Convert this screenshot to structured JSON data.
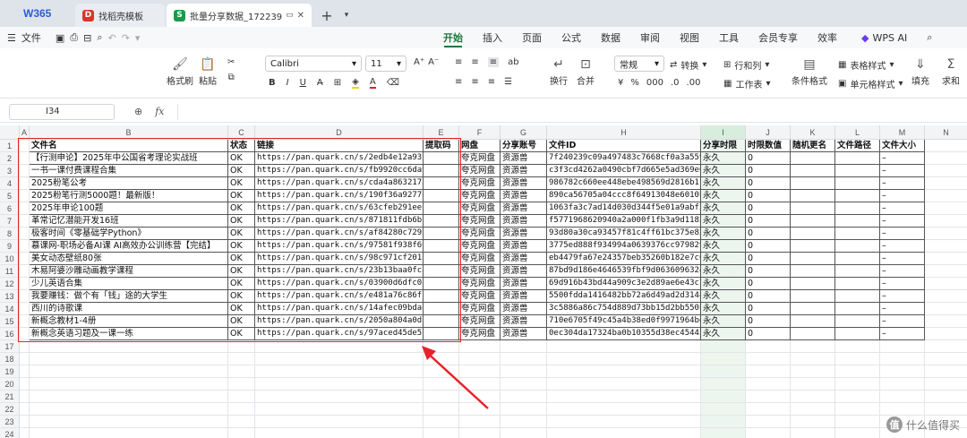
{
  "app": {
    "logo": "W365"
  },
  "tabs": [
    {
      "label": "找稻壳模板",
      "icon_color": "#d9362b",
      "icon_char": "D"
    },
    {
      "label": "批量分享数据_1722396579.xl",
      "icon_color": "#1a9a4a",
      "icon_char": "S"
    }
  ],
  "menu": {
    "file": "文件",
    "items": [
      "开始",
      "插入",
      "页面",
      "公式",
      "数据",
      "审阅",
      "视图",
      "工具",
      "会员专享",
      "效率"
    ],
    "selected_index": 0,
    "wps_ai": "WPS AI"
  },
  "ribbon": {
    "format_painter": "格式刷",
    "paste": "粘贴",
    "font_name": "Calibri",
    "font_size": "11",
    "wrap": "换行",
    "merge": "合并",
    "number_format": "常规",
    "convert": "转换",
    "row_col": "行和列",
    "worksheet": "工作表",
    "cond_format": "条件格式",
    "table_style": "表格样式",
    "cell_style": "单元格样式",
    "fill": "填充",
    "sum": "求和"
  },
  "formula": {
    "cell_ref": "I34"
  },
  "sheet": {
    "columns": [
      "A",
      "B",
      "C",
      "D",
      "E",
      "F",
      "G",
      "H",
      "I",
      "J",
      "K",
      "L",
      "M",
      "N"
    ],
    "selected_column": "I",
    "row_numbers": [
      "1",
      "2",
      "3",
      "4",
      "5",
      "6",
      "7",
      "8",
      "9",
      "10",
      "11",
      "12",
      "13",
      "14",
      "15",
      "16",
      "17",
      "18",
      "19",
      "20",
      "21",
      "22",
      "23",
      "24"
    ],
    "header": [
      "文件名",
      "状态",
      "链接",
      "提取码",
      "网盘",
      "分享账号",
      "文件ID",
      "分享时限",
      "时限数值",
      "随机更名",
      "文件路径",
      "文件大小"
    ],
    "rows": [
      [
        "【行测申论】2025年中公国省考理论实战班",
        "OK",
        "https://pan.quark.cn/s/2edb4e12a932",
        "",
        "夸克网盘",
        "资源兽",
        "7f240239c09a497483c7668cf0a3a559",
        "永久",
        "0",
        "",
        "",
        "–"
      ],
      [
        "一书一课付费课程合集",
        "OK",
        "https://pan.quark.cn/s/fb9920cc6da9",
        "",
        "夸克网盘",
        "资源兽",
        "c3f3cd4262a0490cbf7d665e5ad369e6",
        "永久",
        "0",
        "",
        "",
        "–"
      ],
      [
        "2025粉笔公考",
        "OK",
        "https://pan.quark.cn/s/cda4a8632173",
        "",
        "夸克网盘",
        "资源兽",
        "986782c660ee448ebe498569d2816b1c",
        "永久",
        "0",
        "",
        "",
        "–"
      ],
      [
        "2025粉笔行测5000题！最新版！",
        "OK",
        "https://pan.quark.cn/s/190f36a9277e",
        "",
        "夸克网盘",
        "资源兽",
        "890ca56705a04ccc8f64913048e6010b",
        "永久",
        "0",
        "",
        "",
        "–"
      ],
      [
        "2025年申论100题",
        "OK",
        "https://pan.quark.cn/s/63cfeb291eec",
        "",
        "夸克网盘",
        "资源兽",
        "1063fa3c7ad14d030d344f5e01a9abf3",
        "永久",
        "0",
        "",
        "",
        "–"
      ],
      [
        "革常记忆潜能开发16班",
        "OK",
        "https://pan.quark.cn/s/871811fdb6bf",
        "",
        "夸克网盘",
        "资源兽",
        "f5771968620940a2a000f1fb3a9d1185",
        "永久",
        "0",
        "",
        "",
        "–"
      ],
      [
        "极客时间《零基础学Python》",
        "OK",
        "https://pan.quark.cn/s/af84280c7293",
        "",
        "夸克网盘",
        "资源兽",
        "93d80a30ca93457f81c4ff61bc375e82",
        "永久",
        "0",
        "",
        "",
        "–"
      ],
      [
        "慕课网-职场必备AI课 AI高效办公训练营【完结】",
        "OK",
        "https://pan.quark.cn/s/97581f938f66",
        "",
        "夸克网盘",
        "资源兽",
        "3775ed888f934994a0639376cc979829",
        "永久",
        "0",
        "",
        "",
        "–"
      ],
      [
        "美女动态壁纸80张",
        "OK",
        "https://pan.quark.cn/s/98c971cf201a",
        "",
        "夸克网盘",
        "资源兽",
        "eb4479fa67e24357beb35260b182e7c6",
        "永久",
        "0",
        "",
        "",
        "–"
      ],
      [
        "木易阿婆沙雕动画教学课程",
        "OK",
        "https://pan.quark.cn/s/23b13baa0fca",
        "",
        "夸克网盘",
        "资源兽",
        "87bd9d186e4646539fbf9d0636096324",
        "永久",
        "0",
        "",
        "",
        "–"
      ],
      [
        "少儿英语合集",
        "OK",
        "https://pan.quark.cn/s/03900d6dfc0a",
        "",
        "夸克网盘",
        "资源兽",
        "69d916b43bd44a909c3e2d89ae6e43c7",
        "永久",
        "0",
        "",
        "",
        "–"
      ],
      [
        "我要赚钱：做个有「钱」途的大学生",
        "OK",
        "https://pan.quark.cn/s/e481a76c86ff",
        "",
        "夸克网盘",
        "资源兽",
        "5500fdda1416482bb72a6d49ad2d3144",
        "永久",
        "0",
        "",
        "",
        "–"
      ],
      [
        "西川的诗歌课",
        "OK",
        "https://pan.quark.cn/s/14afec09bdae",
        "",
        "夸克网盘",
        "资源兽",
        "3c5886a86c754d889d73bb15d2bb550b",
        "永久",
        "0",
        "",
        "",
        "–"
      ],
      [
        "新概念教材1-4册",
        "OK",
        "https://pan.quark.cn/s/2050a804a0dc",
        "",
        "夸克网盘",
        "资源兽",
        "710e6705f49c45a4b38ed0f9971964bd",
        "永久",
        "0",
        "",
        "",
        "–"
      ],
      [
        "新概念英语习题及一课一练",
        "OK",
        "https://pan.quark.cn/s/97aced45de5f",
        "",
        "夸克网盘",
        "资源兽",
        "0ec304da17324ba0b10355d38ec45443",
        "永久",
        "0",
        "",
        "",
        "–"
      ]
    ]
  },
  "watermark": {
    "text": "什么值得买",
    "badge": "值"
  },
  "colors": {
    "accent": "#1a7a3d",
    "highlight": "#e8222a"
  }
}
